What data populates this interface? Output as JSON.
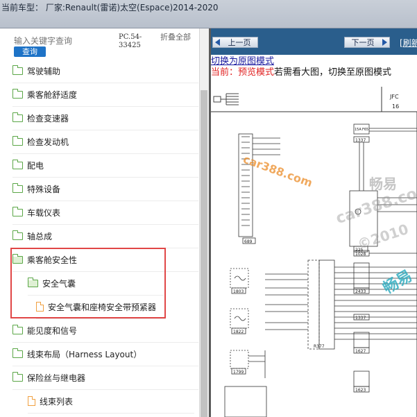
{
  "window": {
    "title": "当前车型： 厂家:Renault(雷诺)太空(Espace)2014-2020"
  },
  "sidebar": {
    "search_placeholder": "输入关键字查询",
    "search_button": "查询",
    "part_number": "PC.54-33425",
    "collapse_all": "折叠全部",
    "items": [
      {
        "label": "驾驶辅助",
        "type": "folder"
      },
      {
        "label": "乘客舱舒适度",
        "type": "folder"
      },
      {
        "label": "检查变速器",
        "type": "folder"
      },
      {
        "label": "检查发动机",
        "type": "folder"
      },
      {
        "label": "配电",
        "type": "folder"
      },
      {
        "label": "特殊设备",
        "type": "folder"
      },
      {
        "label": "车载仪表",
        "type": "folder"
      },
      {
        "label": "轴总成",
        "type": "folder"
      },
      {
        "label": "乘客舱安全性",
        "type": "folder-open"
      },
      {
        "label": "安全气囊",
        "type": "folder-open"
      },
      {
        "label": "安全气囊和座椅安全带预紧器",
        "type": "file"
      },
      {
        "label": "能见度和信号",
        "type": "folder"
      },
      {
        "label": "线束布局（Harness Layout）",
        "type": "folder"
      },
      {
        "label": "保险丝与继电器",
        "type": "folder"
      },
      {
        "label": "线束列表",
        "type": "file"
      }
    ]
  },
  "viewer": {
    "prev_label": "上一页",
    "next_label": "下一页",
    "refresh_label": "[刷新",
    "switch_link": "切换为原图模式",
    "status_prefix": "当前：",
    "status_mode": "预览模式",
    "status_hint": "若需看大图，切换至原图模式"
  },
  "diagram": {
    "header_code": "JFC",
    "header_num": "16",
    "labels": [
      "15A",
      "F65",
      "1337",
      "225",
      "689",
      "1028",
      "2433",
      "1803",
      "1822",
      "1799",
      "R377",
      "1337",
      "1627",
      "1623"
    ],
    "watermarks": [
      "car388.com",
      "畅易",
      "car388.co",
      "©2010",
      "畅易"
    ]
  },
  "colors": {
    "accent": "#1e73c7",
    "navbar": "#2a5e8c",
    "highlight": "#e04646",
    "status_red": "#e02020"
  }
}
